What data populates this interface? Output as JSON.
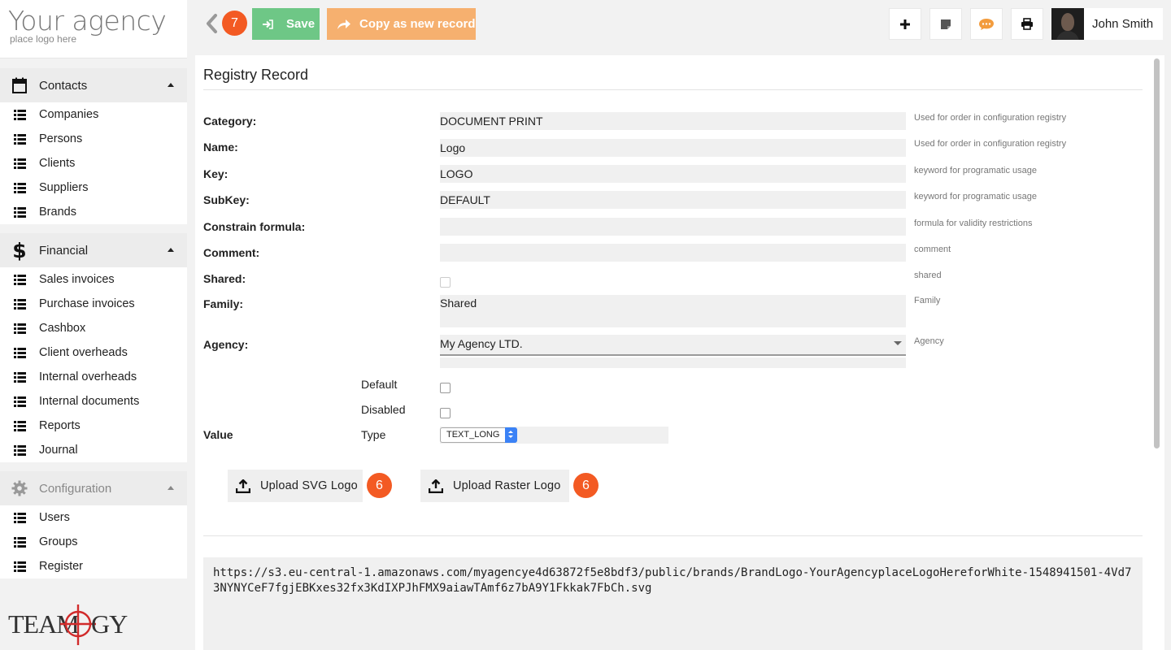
{
  "brand": {
    "logo_text": "Your agency",
    "logo_sub": "place logo here",
    "footer_logo": "TEAMOGY"
  },
  "toolbar": {
    "badge": "7",
    "save_label": "Save",
    "copy_label": "Copy as new record",
    "user_name": "John Smith",
    "colors": {
      "save": "#6ec786",
      "copy": "#f6b06f",
      "badge": "#f35a23"
    }
  },
  "sidebar": {
    "sections": [
      {
        "title": "Contacts",
        "icon": "calendar-icon",
        "items": [
          "Companies",
          "Persons",
          "Clients",
          "Suppliers",
          "Brands"
        ]
      },
      {
        "title": "Financial",
        "icon": "dollar-icon",
        "items": [
          "Sales invoices",
          "Purchase invoices",
          "Cashbox",
          "Client overheads",
          "Internal overheads",
          "Internal documents",
          "Reports",
          "Journal"
        ]
      },
      {
        "title": "Configuration",
        "icon": "gear-icon",
        "items": [
          "Users",
          "Groups",
          "Register"
        ]
      }
    ]
  },
  "form": {
    "title": "Registry Record",
    "fields": {
      "category": {
        "label": "Category:",
        "value": "DOCUMENT PRINT",
        "hint": "Used for order in configuration registry"
      },
      "name": {
        "label": "Name:",
        "value": "Logo",
        "hint": "Used for order in configuration registry"
      },
      "key": {
        "label": "Key:",
        "value": "LOGO",
        "hint": "keyword for programatic usage"
      },
      "subkey": {
        "label": "SubKey:",
        "value": "DEFAULT",
        "hint": "keyword for programatic usage"
      },
      "constrain": {
        "label": "Constrain formula:",
        "value": "",
        "hint": "formula for validity restrictions"
      },
      "comment": {
        "label": "Comment:",
        "value": "",
        "hint": "comment"
      },
      "shared": {
        "label": "Shared:",
        "hint": "shared"
      },
      "family": {
        "label": "Family:",
        "value": "Shared",
        "hint": "Family"
      },
      "agency": {
        "label": "Agency:",
        "value": "My Agency LTD.",
        "hint": "Agency"
      }
    },
    "default_label": "Default",
    "disabled_label": "Disabled",
    "value_label": "Value",
    "type_label": "Type",
    "type_value": "TEXT_LONG",
    "upload_svg": "Upload SVG Logo",
    "upload_raster": "Upload Raster Logo",
    "upload_svg_badge": "6",
    "upload_raster_badge": "6",
    "value_text": "https://s3.eu-central-1.amazonaws.com/myagencye4d63872f5e8bdf3/public/brands/BrandLogo-YourAgencyplaceLogoHereforWhite-1548941501-4Vd73NYNYCeF7fgjEBKxes32fx3KdIXPJhFMX9aiawTAmf6z7bA9Y1Fkkak7FbCh.svg"
  }
}
